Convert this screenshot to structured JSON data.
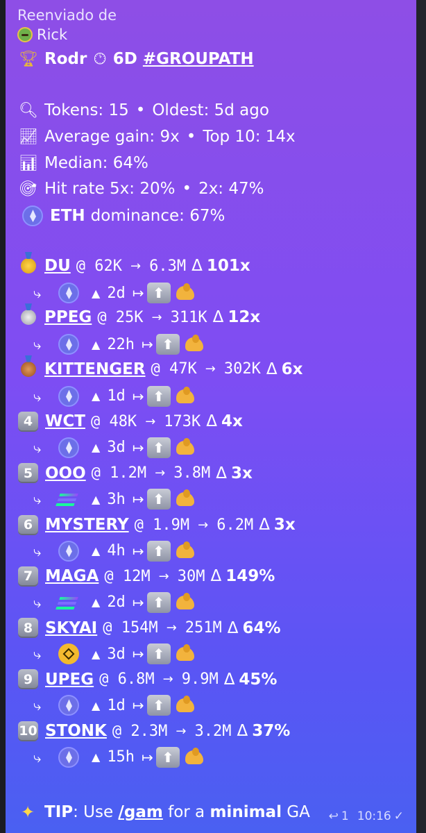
{
  "forwarded": {
    "label": "Reenviado de",
    "from": "Rick"
  },
  "title": {
    "prefix": "Rodr",
    "period": "6D",
    "hashtag": "#GROUPATH"
  },
  "stats": {
    "tokens": "Tokens: 15",
    "oldest": "Oldest: 5d ago",
    "avg": "Average gain: 9x",
    "top10": "Top 10: 14x",
    "median": "Median: 64%",
    "hit_label": "Hit rate 5x: 20%",
    "hit2": "2x: 47%",
    "eth_dom_prefix": "ETH",
    "eth_dom_rest": "dominance: 67%"
  },
  "entries": [
    {
      "rank": "1",
      "token": "DU",
      "from": "@ 62K",
      "to": "6.3M",
      "delta": "101x",
      "chain": "eth",
      "age": "2d"
    },
    {
      "rank": "2",
      "token": "PPEG",
      "from": "@ 25K",
      "to": "311K",
      "delta": "12x",
      "chain": "eth",
      "age": "22h"
    },
    {
      "rank": "3",
      "token": "KITTENGER",
      "from": "@ 47K",
      "to": "302K",
      "delta": "6x",
      "chain": "eth",
      "age": "1d"
    },
    {
      "rank": "4",
      "token": "WCT",
      "from": "@ 48K",
      "to": "173K",
      "delta": "4x",
      "chain": "eth",
      "age": "3d"
    },
    {
      "rank": "5",
      "token": "OOO",
      "from": "@ 1.2M",
      "to": "3.8M",
      "delta": "3x",
      "chain": "sol",
      "age": "3h"
    },
    {
      "rank": "6",
      "token": "MYSTERY",
      "from": "@ 1.9M",
      "to": "6.2M",
      "delta": "3x",
      "chain": "eth",
      "age": "4h"
    },
    {
      "rank": "7",
      "token": "MAGA",
      "from": "@ 12M",
      "to": "30M",
      "delta": "149%",
      "chain": "sol",
      "age": "2d"
    },
    {
      "rank": "8",
      "token": "SKYAI",
      "from": "@ 154M",
      "to": "251M",
      "delta": "64%",
      "chain": "bnb",
      "age": "3d"
    },
    {
      "rank": "9",
      "token": "UPEG",
      "from": "@ 6.8M",
      "to": "9.9M",
      "delta": "45%",
      "chain": "eth",
      "age": "1d"
    },
    {
      "rank": "10",
      "token": "STONK",
      "from": "@ 2.3M",
      "to": "3.2M",
      "delta": "37%",
      "chain": "eth",
      "age": "15h"
    }
  ],
  "tip": {
    "label": "TIP",
    "text1": ": Use ",
    "cmd": "/gam",
    "text2": " for a ",
    "bold": "minimal",
    "text3": " GA"
  },
  "meta": {
    "replies": "1",
    "time": "10:16"
  },
  "symbols": {
    "arrow": "→",
    "delta_sym": "Δ",
    "hook": "⤷",
    "up_tri": "▲",
    "maps_to": "↦",
    "sep": "•"
  }
}
